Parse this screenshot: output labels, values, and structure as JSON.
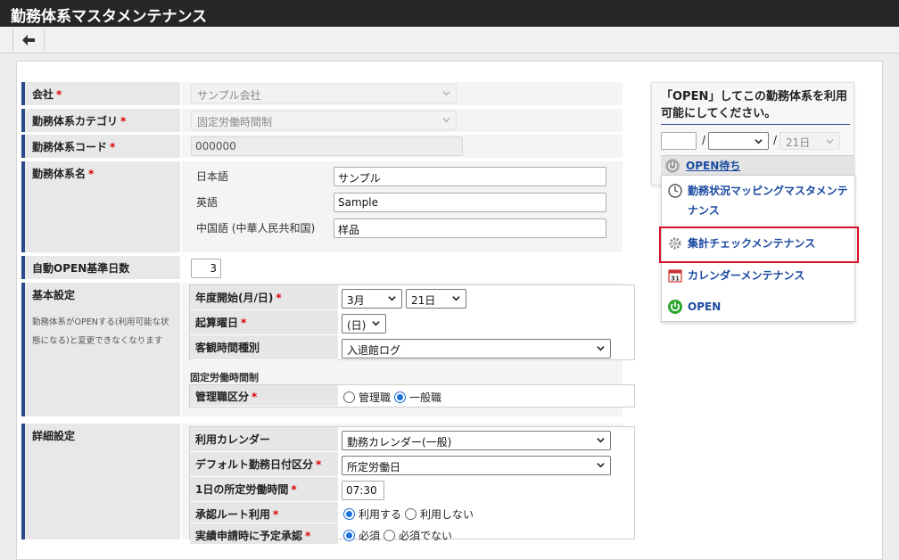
{
  "window": {
    "title": "勤務体系マスタメンテナンス"
  },
  "toolbar": {
    "back_icon": "back-arrow-icon"
  },
  "form": {
    "company": {
      "label": "会社",
      "value": "サンプル会社"
    },
    "category": {
      "label": "勤務体系カテゴリ",
      "value": "固定労働時間制"
    },
    "code": {
      "label": "勤務体系コード",
      "value": "000000"
    },
    "name": {
      "label": "勤務体系名",
      "ja_label": "日本語",
      "ja_value": "サンプル",
      "en_label": "英語",
      "en_value": "Sample",
      "zh_label": "中国語 (中華人民共和国)",
      "zh_value": "样品"
    },
    "auto_open": {
      "label": "自動OPEN基準日数",
      "value": "3"
    },
    "basic": {
      "label": "基本設定",
      "desc": "勤務体系がOPENする(利用可能な状態になる)と変更できなくなります",
      "fiscal_start": {
        "label": "年度開始(月/日)",
        "month": "3月",
        "day": "21日"
      },
      "start_weekday": {
        "label": "起算曜日",
        "value": "(日)"
      },
      "time_type": {
        "label": "客観時間種別",
        "value": "入退館ログ"
      },
      "sub_caption": "固定労働時間制",
      "manager_type": {
        "label": "管理職区分",
        "opt1": "管理職",
        "opt2": "一般職"
      }
    },
    "detail": {
      "label": "詳細設定",
      "calendar": {
        "label": "利用カレンダー",
        "value": "勤務カレンダー(一般)"
      },
      "default_day": {
        "label": "デフォルト勤務日付区分",
        "value": "所定労働日"
      },
      "daily_hours": {
        "label": "1日の所定労働時間",
        "value": "07:30"
      },
      "approval_route": {
        "label": "承認ルート利用",
        "opt1": "利用する",
        "opt2": "利用しない"
      },
      "pre_approval": {
        "label": "実績申請時に予定承認",
        "opt1": "必須",
        "opt2": "必須でない"
      }
    },
    "required_mark": "*"
  },
  "open_panel": {
    "message": "「OPEN」してこの勤務体系を利用可能にしてください。",
    "date_sep": "/",
    "day_value": "21日",
    "status": "OPEN待ち"
  },
  "menu": {
    "items": [
      {
        "label": "勤務状況マッピングマスタメンテナンス",
        "icon": "clock-icon"
      },
      {
        "label": "集計チェックメンテナンス",
        "icon": "gear-icon"
      },
      {
        "label": "カレンダーメンテナンス",
        "icon": "calendar-icon"
      },
      {
        "label": "OPEN",
        "icon": "power-icon"
      }
    ]
  },
  "colors": {
    "accent": "#2b4a8c",
    "link": "#1a4aa0",
    "highlight": "#d8102a",
    "titlebar": "#262626"
  }
}
